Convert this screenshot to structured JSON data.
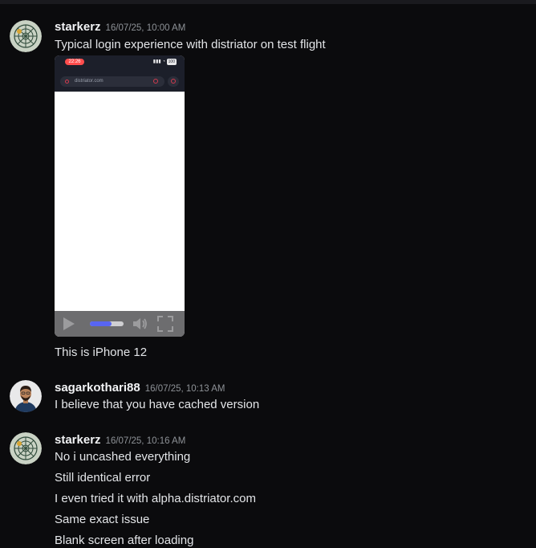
{
  "messages": [
    {
      "username": "starkerz",
      "timestamp": "16/07/25, 10:00 AM",
      "lines": [
        "Typical login experience with distriator on test flight"
      ],
      "video": {
        "status_time": "22:26",
        "status_battery": "100",
        "url": "distriator.com",
        "progress": 0.65
      },
      "after_lines": [
        "This is iPhone 12"
      ]
    },
    {
      "username": "sagarkothari88",
      "timestamp": "16/07/25, 10:13 AM",
      "lines": [
        "I believe that you have cached version"
      ]
    },
    {
      "username": "starkerz",
      "timestamp": "16/07/25, 10:16 AM",
      "lines": [
        "No i uncashed everything",
        "Still identical error",
        "I even tried it with alpha.distriator.com",
        "Same exact issue",
        "Blank screen after loading"
      ]
    }
  ],
  "colors": {
    "background": "#0b0b0d",
    "accent": "#5865f2",
    "username": "#f2f3f5",
    "timestamp": "#8e9297"
  },
  "icons": [
    "starkerz-avatar",
    "sagarkothari88-avatar",
    "play-icon",
    "volume-icon",
    "fullscreen-icon"
  ]
}
